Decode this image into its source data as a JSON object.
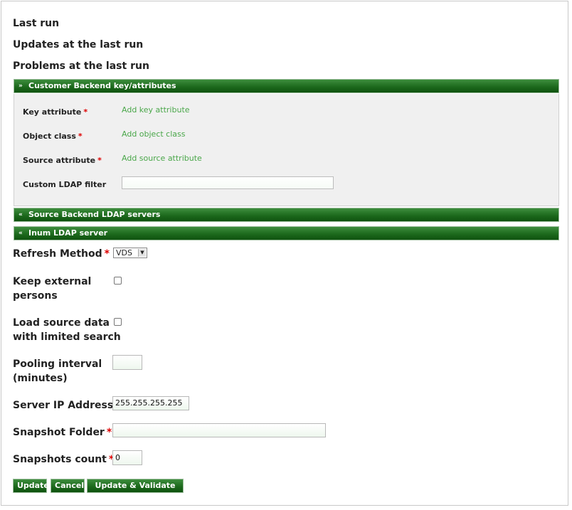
{
  "headings": {
    "last_run": "Last run",
    "updates_last_run": "Updates at the last run",
    "problems_last_run": "Problems at the last run"
  },
  "panels": {
    "customer_backend": {
      "title": "Customer Backend key/attributes",
      "expanded": true,
      "fields": {
        "key_attribute": {
          "label": "Key attribute",
          "required": "*",
          "link": "Add key attribute"
        },
        "object_class": {
          "label": "Object class",
          "required": "*",
          "link": "Add object class"
        },
        "source_attribute": {
          "label": "Source attribute",
          "required": "*",
          "link": "Add source attribute"
        },
        "custom_ldap_filter": {
          "label": "Custom LDAP filter",
          "value": ""
        }
      }
    },
    "source_backend": {
      "title": "Source Backend LDAP servers",
      "expanded": false
    },
    "inum_ldap": {
      "title": "Inum LDAP server",
      "expanded": false
    }
  },
  "form": {
    "refresh_method": {
      "label": "Refresh Method",
      "required": "*",
      "value": "VDS"
    },
    "keep_external": {
      "label_line1": "Keep external",
      "label_line2": "persons",
      "checked": false
    },
    "load_source": {
      "label_line1": "Load source data",
      "label_line2": "with limited search",
      "checked": false
    },
    "pooling_interval": {
      "label_line1": "Pooling interval",
      "label_line2": "(minutes)",
      "value": ""
    },
    "server_ip": {
      "label": "Server IP Address",
      "value": "255.255.255.255"
    },
    "snapshot_folder": {
      "label": "Snapshot Folder",
      "required": "*",
      "value": ""
    },
    "snapshots_count": {
      "label": "Snapshots count",
      "required": "*",
      "value": "0"
    }
  },
  "buttons": {
    "update": "Update",
    "cancel": "Cancel",
    "update_validate": "Update & Validate script"
  },
  "icons": {
    "expanded": "chevron-double-down-icon",
    "collapsed": "chevron-double-up-icon"
  },
  "colors": {
    "accent_green": "#1d6a1d",
    "link_green": "#4aa74a",
    "required_red": "#dd0000"
  }
}
